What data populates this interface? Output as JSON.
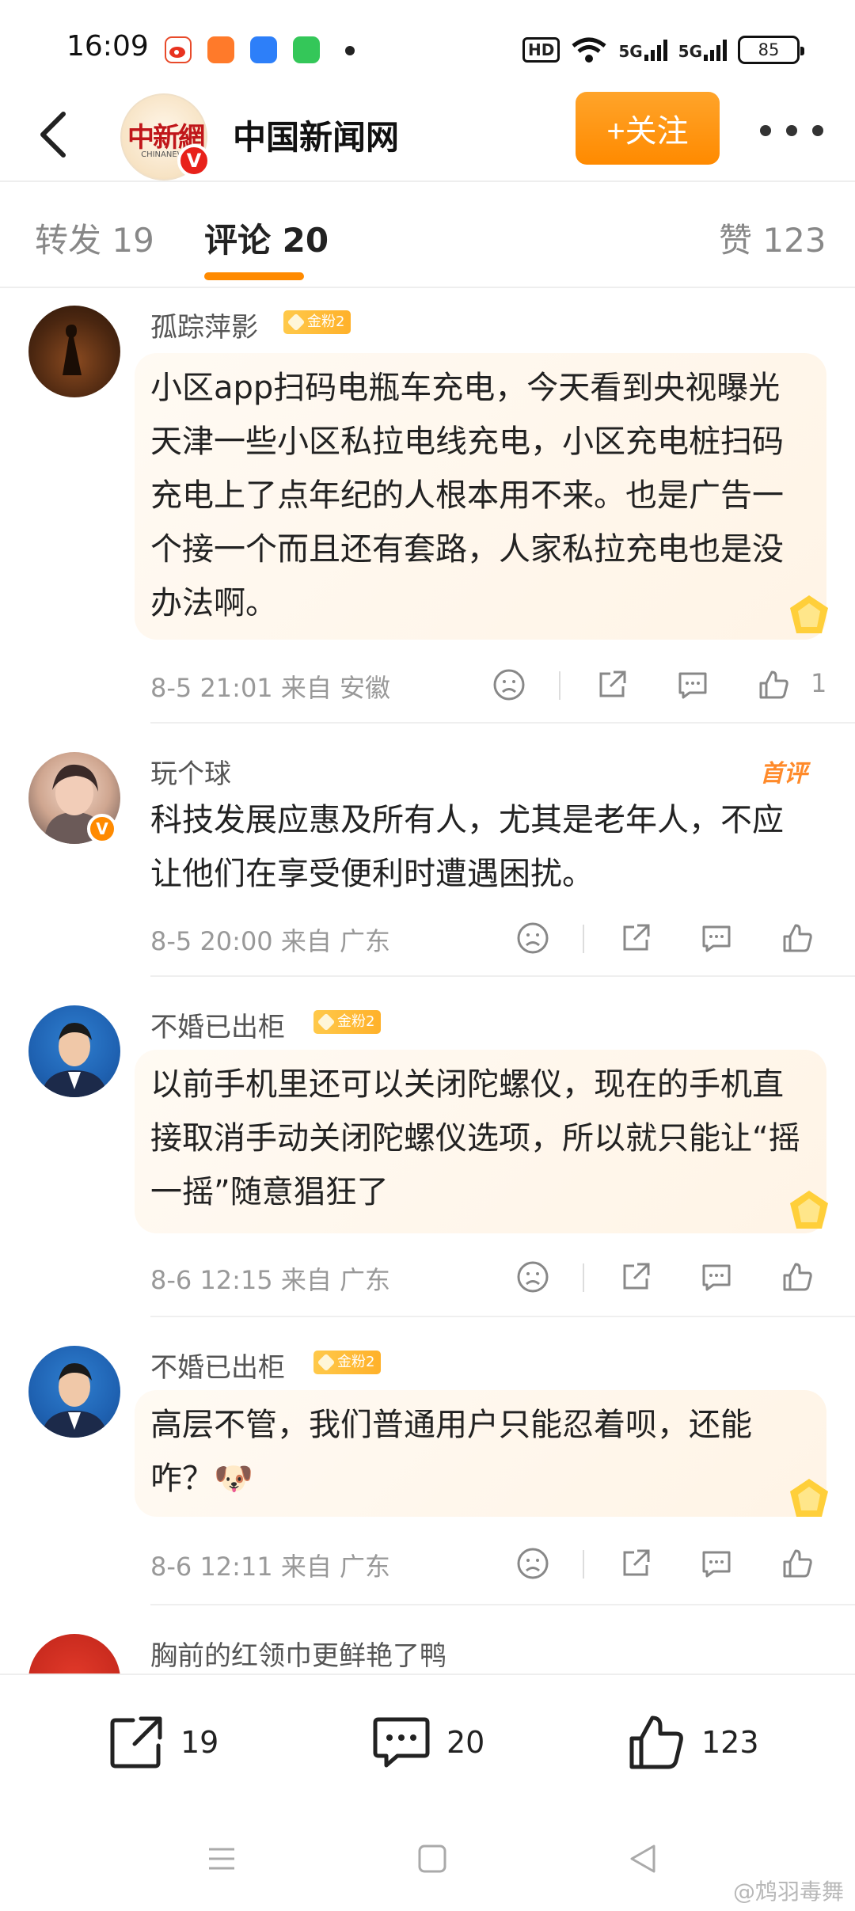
{
  "status_bar": {
    "time": "16:09",
    "apps": [
      "weibo-app-icon",
      "orange-app-icon",
      "blue-app-icon",
      "green-app-icon"
    ],
    "hd": "HD",
    "signal1": "5G",
    "signal2": "5G",
    "battery": "85"
  },
  "header": {
    "logo_text": "中新網",
    "logo_sub": "CHINANEWS",
    "verified": "V",
    "title": "中国新闻网",
    "follow_label": "+关注"
  },
  "tabs": [
    {
      "label": "转发 19"
    },
    {
      "label": "评论 20"
    },
    {
      "label": "赞 123"
    }
  ],
  "comments": [
    {
      "username": "孤踪萍影",
      "badge": "金粉2",
      "text": "小区app扫码电瓶车充电，今天看到央视曝光天津一些小区私拉电线充电，小区充电桩扫码充电上了点年纪的人根本用不来。也是广告一个接一个而且还有套路，人家私拉充电也是没办法啊。",
      "meta": "8-5 21:01  来自 安徽",
      "likes": "1"
    },
    {
      "username": "玩个球",
      "first_label": "首评",
      "verified": "V",
      "text": "科技发展应惠及所有人，尤其是老年人，不应让他们在享受便利时遭遇困扰。",
      "meta": "8-5 20:00  来自 广东"
    },
    {
      "username": "不婚已出柜",
      "badge": "金粉2",
      "text": "以前手机里还可以关闭陀螺仪，现在的手机直接取消手动关闭陀螺仪选项，所以就只能让“摇一摇”随意猖狂了",
      "meta": "8-6 12:15  来自 广东"
    },
    {
      "username": "不婚已出柜",
      "badge": "金粉2",
      "text": "高层不管，我们普通用户只能忍着呗，还能咋？",
      "emoji": "🐶",
      "meta": "8-6 12:11  来自 广东"
    },
    {
      "username": "胸前的红领巾更鲜艳了鸭"
    }
  ],
  "bottom_bar": {
    "repost_count": "19",
    "comment_count": "20",
    "like_count": "123"
  },
  "watermark": "@鸩羽毒舞",
  "colors": {
    "accent": "#ff8a00",
    "bubble": "#fff4e6",
    "muted": "#999999"
  }
}
